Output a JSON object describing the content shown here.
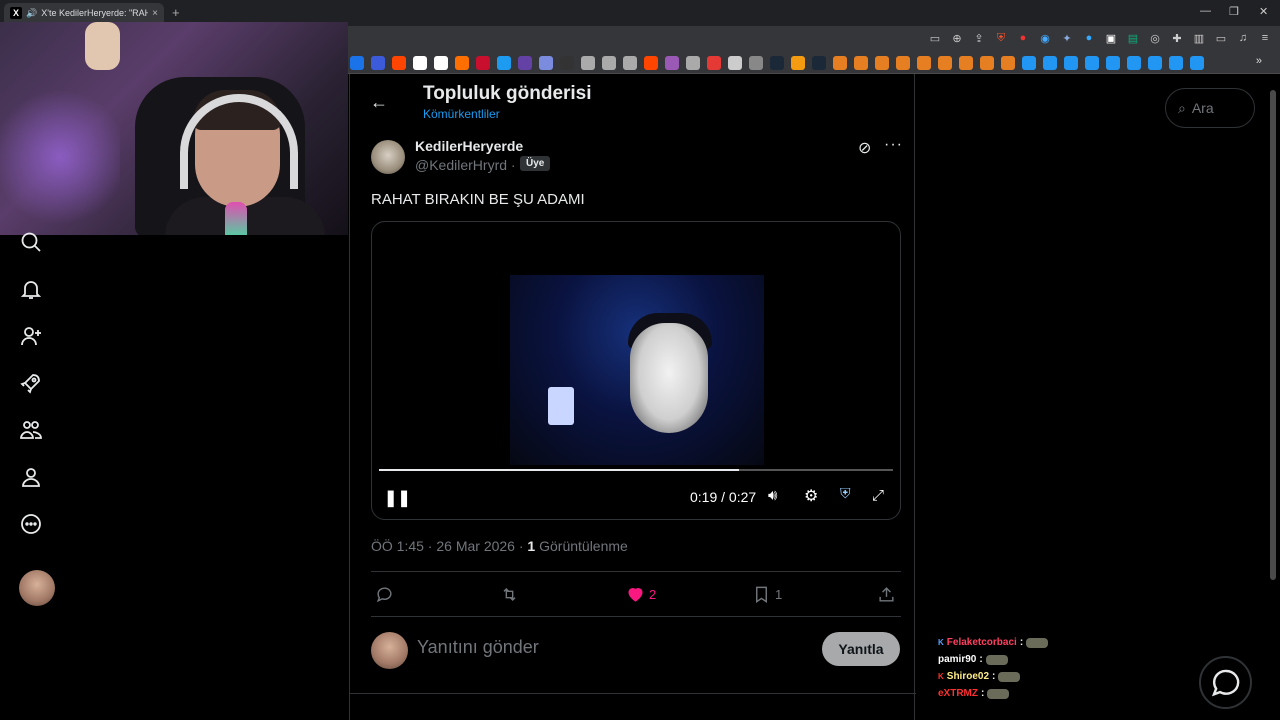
{
  "browser": {
    "tab_title": "X'te KedilerHeryerde: \"RAHAT",
    "tab_close": "×",
    "new_tab": "+",
    "window_controls": [
      "—",
      "❐",
      "✕"
    ]
  },
  "nav": {
    "icons": [
      "search-icon",
      "bell-icon",
      "add-user-icon",
      "rocket-icon",
      "communities-icon",
      "profile-icon",
      "more-circle-icon"
    ]
  },
  "header": {
    "back": "←",
    "title": "Topluluk gönderisi",
    "community": "Kömürkentliler"
  },
  "post": {
    "author_name": "KedilerHeryerde",
    "author_handle": "@KedilerHryrd",
    "separator": "·",
    "member_badge": "Üye",
    "more": "···",
    "text": "RAHAT BIRAKIN BE ŞU ADAMI",
    "video": {
      "time": "0:19 / 0:27",
      "progress_fraction": 0.7
    },
    "meta": {
      "time": "ÖÖ 1:45 · 26 Mar 2026 ·",
      "views_count": "1",
      "views_label": "Görüntülenme"
    },
    "actions": {
      "likes": "2",
      "bookmarks": "1"
    }
  },
  "reply": {
    "placeholder": "Yanıtını gönder",
    "button": "Yanıtla"
  },
  "search": {
    "placeholder": "Ara"
  },
  "chat": {
    "lines": [
      {
        "user": "Felaketcorbaci",
        "sep": ":",
        "color": "#ff4060",
        "badge": "K",
        "badge_color": "#5aa0ff"
      },
      {
        "user": "pamir90",
        "sep": ":",
        "color": "#ffffff",
        "badge": "",
        "badge_color": ""
      },
      {
        "user": "Shiroe02",
        "sep": ":",
        "color": "#ffee88",
        "badge": "K",
        "badge_color": "#ff3030"
      },
      {
        "user": "eXTRMZ",
        "sep": ":",
        "color": "#ff3030",
        "badge": "",
        "badge_color": ""
      }
    ]
  },
  "colors": {
    "accent": "#1d9bf0",
    "like": "#f91880",
    "border": "#2f3336",
    "muted": "#71767b"
  }
}
